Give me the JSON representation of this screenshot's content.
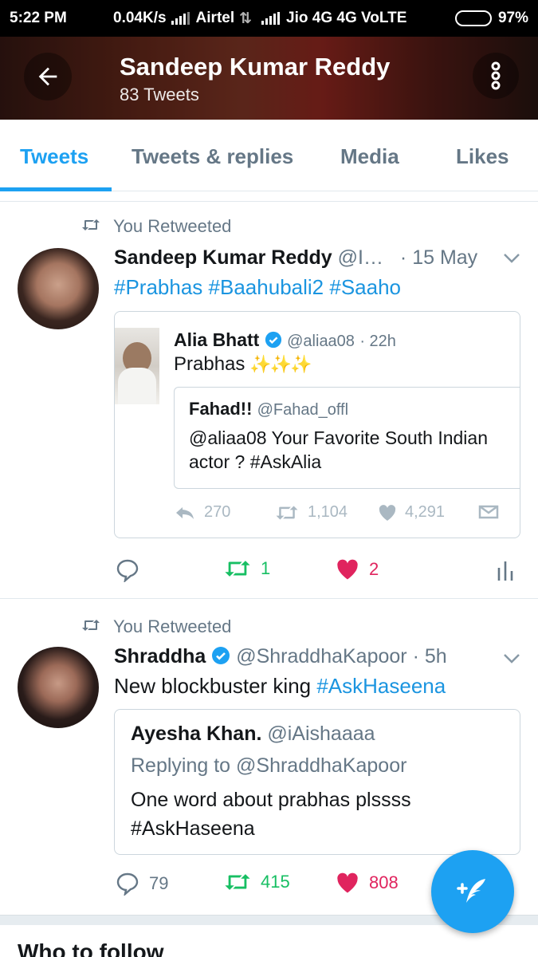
{
  "status_bar": {
    "time": "5:22 PM",
    "speed": "0.04K/s",
    "carrier1": "Airtel",
    "carrier2": "Jio 4G 4G VoLTE",
    "battery_percent": 97,
    "battery_text": "97%"
  },
  "header": {
    "name": "Sandeep Kumar Reddy",
    "tweet_count": "83 Tweets",
    "back_icon": "back-arrow-icon",
    "more_icon": "more-vertical-icon"
  },
  "tabs": [
    {
      "label": "Tweets",
      "active": true
    },
    {
      "label": "Tweets & replies",
      "active": false
    },
    {
      "label": "Media",
      "active": false
    },
    {
      "label": "Likes",
      "active": false
    }
  ],
  "tweets": [
    {
      "retweet_label": "You Retweeted",
      "name": "Sandeep Kumar Reddy",
      "handle": "@I…",
      "time": "· 15 May",
      "text_tags": [
        "#Prabhas",
        "#Baahubali2",
        "#Saaho"
      ],
      "quote": {
        "name": "Alia Bhatt",
        "handle": "@aliaa08",
        "time": "· 22h",
        "text": "Prabhas",
        "inner": {
          "name": "Fahad!!",
          "handle": "@Fahad_offl",
          "line1": "@aliaa08 Your Favorite South Indian",
          "line2": "actor ? #AskAlia"
        },
        "replies": "270",
        "retweets": "1,104",
        "likes": "4,291"
      },
      "retweets": "1",
      "likes": "2"
    },
    {
      "retweet_label": "You Retweeted",
      "name": "Shraddha",
      "handle": "@ShraddhaKapoor",
      "time": "· 5h",
      "text_plain": "New blockbuster king ",
      "text_tag": "#AskHaseena",
      "quote": {
        "name": "Ayesha Khan.",
        "handle": "@iAishaaaa",
        "replying": "Replying to @ShraddhaKapoor",
        "line1": "One word about prabhas plssss",
        "line2": "#AskHaseena"
      },
      "replies": "79",
      "retweets": "415",
      "likes": "808"
    }
  ],
  "who_to_follow": "Who to follow",
  "colors": {
    "accent": "#1da1f2",
    "retweet_green": "#17bf63",
    "like_red": "#e0245e",
    "secondary_text": "#657786"
  }
}
